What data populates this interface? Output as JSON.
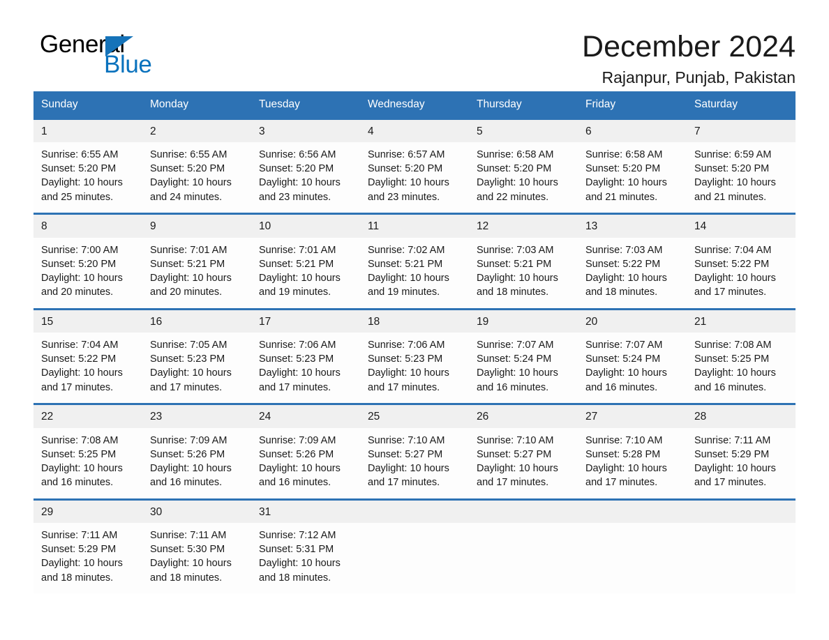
{
  "logo": {
    "word_general": "General",
    "word_blue": "Blue",
    "triangle_color": "#1573b9",
    "blue_text_color": "#0a72bd"
  },
  "header": {
    "title": "December 2024",
    "location": "Rajanpur, Punjab, Pakistan"
  },
  "theme": {
    "header_blue": "#2d72b4",
    "daynum_band": "#f0f0f0",
    "cell_background": "#fdfdfd",
    "text": "#1a1a1a"
  },
  "calendar": {
    "weekdays": [
      "Sunday",
      "Monday",
      "Tuesday",
      "Wednesday",
      "Thursday",
      "Friday",
      "Saturday"
    ],
    "weeks": [
      {
        "daynums": [
          "1",
          "2",
          "3",
          "4",
          "5",
          "6",
          "7"
        ],
        "cells": [
          {
            "l1": "Sunrise: 6:55 AM",
            "l2": "Sunset: 5:20 PM",
            "l3": "Daylight: 10 hours",
            "l4": "and 25 minutes."
          },
          {
            "l1": "Sunrise: 6:55 AM",
            "l2": "Sunset: 5:20 PM",
            "l3": "Daylight: 10 hours",
            "l4": "and 24 minutes."
          },
          {
            "l1": "Sunrise: 6:56 AM",
            "l2": "Sunset: 5:20 PM",
            "l3": "Daylight: 10 hours",
            "l4": "and 23 minutes."
          },
          {
            "l1": "Sunrise: 6:57 AM",
            "l2": "Sunset: 5:20 PM",
            "l3": "Daylight: 10 hours",
            "l4": "and 23 minutes."
          },
          {
            "l1": "Sunrise: 6:58 AM",
            "l2": "Sunset: 5:20 PM",
            "l3": "Daylight: 10 hours",
            "l4": "and 22 minutes."
          },
          {
            "l1": "Sunrise: 6:58 AM",
            "l2": "Sunset: 5:20 PM",
            "l3": "Daylight: 10 hours",
            "l4": "and 21 minutes."
          },
          {
            "l1": "Sunrise: 6:59 AM",
            "l2": "Sunset: 5:20 PM",
            "l3": "Daylight: 10 hours",
            "l4": "and 21 minutes."
          }
        ]
      },
      {
        "daynums": [
          "8",
          "9",
          "10",
          "11",
          "12",
          "13",
          "14"
        ],
        "cells": [
          {
            "l1": "Sunrise: 7:00 AM",
            "l2": "Sunset: 5:20 PM",
            "l3": "Daylight: 10 hours",
            "l4": "and 20 minutes."
          },
          {
            "l1": "Sunrise: 7:01 AM",
            "l2": "Sunset: 5:21 PM",
            "l3": "Daylight: 10 hours",
            "l4": "and 20 minutes."
          },
          {
            "l1": "Sunrise: 7:01 AM",
            "l2": "Sunset: 5:21 PM",
            "l3": "Daylight: 10 hours",
            "l4": "and 19 minutes."
          },
          {
            "l1": "Sunrise: 7:02 AM",
            "l2": "Sunset: 5:21 PM",
            "l3": "Daylight: 10 hours",
            "l4": "and 19 minutes."
          },
          {
            "l1": "Sunrise: 7:03 AM",
            "l2": "Sunset: 5:21 PM",
            "l3": "Daylight: 10 hours",
            "l4": "and 18 minutes."
          },
          {
            "l1": "Sunrise: 7:03 AM",
            "l2": "Sunset: 5:22 PM",
            "l3": "Daylight: 10 hours",
            "l4": "and 18 minutes."
          },
          {
            "l1": "Sunrise: 7:04 AM",
            "l2": "Sunset: 5:22 PM",
            "l3": "Daylight: 10 hours",
            "l4": "and 17 minutes."
          }
        ]
      },
      {
        "daynums": [
          "15",
          "16",
          "17",
          "18",
          "19",
          "20",
          "21"
        ],
        "cells": [
          {
            "l1": "Sunrise: 7:04 AM",
            "l2": "Sunset: 5:22 PM",
            "l3": "Daylight: 10 hours",
            "l4": "and 17 minutes."
          },
          {
            "l1": "Sunrise: 7:05 AM",
            "l2": "Sunset: 5:23 PM",
            "l3": "Daylight: 10 hours",
            "l4": "and 17 minutes."
          },
          {
            "l1": "Sunrise: 7:06 AM",
            "l2": "Sunset: 5:23 PM",
            "l3": "Daylight: 10 hours",
            "l4": "and 17 minutes."
          },
          {
            "l1": "Sunrise: 7:06 AM",
            "l2": "Sunset: 5:23 PM",
            "l3": "Daylight: 10 hours",
            "l4": "and 17 minutes."
          },
          {
            "l1": "Sunrise: 7:07 AM",
            "l2": "Sunset: 5:24 PM",
            "l3": "Daylight: 10 hours",
            "l4": "and 16 minutes."
          },
          {
            "l1": "Sunrise: 7:07 AM",
            "l2": "Sunset: 5:24 PM",
            "l3": "Daylight: 10 hours",
            "l4": "and 16 minutes."
          },
          {
            "l1": "Sunrise: 7:08 AM",
            "l2": "Sunset: 5:25 PM",
            "l3": "Daylight: 10 hours",
            "l4": "and 16 minutes."
          }
        ]
      },
      {
        "daynums": [
          "22",
          "23",
          "24",
          "25",
          "26",
          "27",
          "28"
        ],
        "cells": [
          {
            "l1": "Sunrise: 7:08 AM",
            "l2": "Sunset: 5:25 PM",
            "l3": "Daylight: 10 hours",
            "l4": "and 16 minutes."
          },
          {
            "l1": "Sunrise: 7:09 AM",
            "l2": "Sunset: 5:26 PM",
            "l3": "Daylight: 10 hours",
            "l4": "and 16 minutes."
          },
          {
            "l1": "Sunrise: 7:09 AM",
            "l2": "Sunset: 5:26 PM",
            "l3": "Daylight: 10 hours",
            "l4": "and 16 minutes."
          },
          {
            "l1": "Sunrise: 7:10 AM",
            "l2": "Sunset: 5:27 PM",
            "l3": "Daylight: 10 hours",
            "l4": "and 17 minutes."
          },
          {
            "l1": "Sunrise: 7:10 AM",
            "l2": "Sunset: 5:27 PM",
            "l3": "Daylight: 10 hours",
            "l4": "and 17 minutes."
          },
          {
            "l1": "Sunrise: 7:10 AM",
            "l2": "Sunset: 5:28 PM",
            "l3": "Daylight: 10 hours",
            "l4": "and 17 minutes."
          },
          {
            "l1": "Sunrise: 7:11 AM",
            "l2": "Sunset: 5:29 PM",
            "l3": "Daylight: 10 hours",
            "l4": "and 17 minutes."
          }
        ]
      },
      {
        "daynums": [
          "29",
          "30",
          "31",
          "",
          "",
          "",
          ""
        ],
        "cells": [
          {
            "l1": "Sunrise: 7:11 AM",
            "l2": "Sunset: 5:29 PM",
            "l3": "Daylight: 10 hours",
            "l4": "and 18 minutes."
          },
          {
            "l1": "Sunrise: 7:11 AM",
            "l2": "Sunset: 5:30 PM",
            "l3": "Daylight: 10 hours",
            "l4": "and 18 minutes."
          },
          {
            "l1": "Sunrise: 7:12 AM",
            "l2": "Sunset: 5:31 PM",
            "l3": "Daylight: 10 hours",
            "l4": "and 18 minutes."
          },
          {
            "l1": "",
            "l2": "",
            "l3": "",
            "l4": ""
          },
          {
            "l1": "",
            "l2": "",
            "l3": "",
            "l4": ""
          },
          {
            "l1": "",
            "l2": "",
            "l3": "",
            "l4": ""
          },
          {
            "l1": "",
            "l2": "",
            "l3": "",
            "l4": ""
          }
        ]
      }
    ]
  }
}
